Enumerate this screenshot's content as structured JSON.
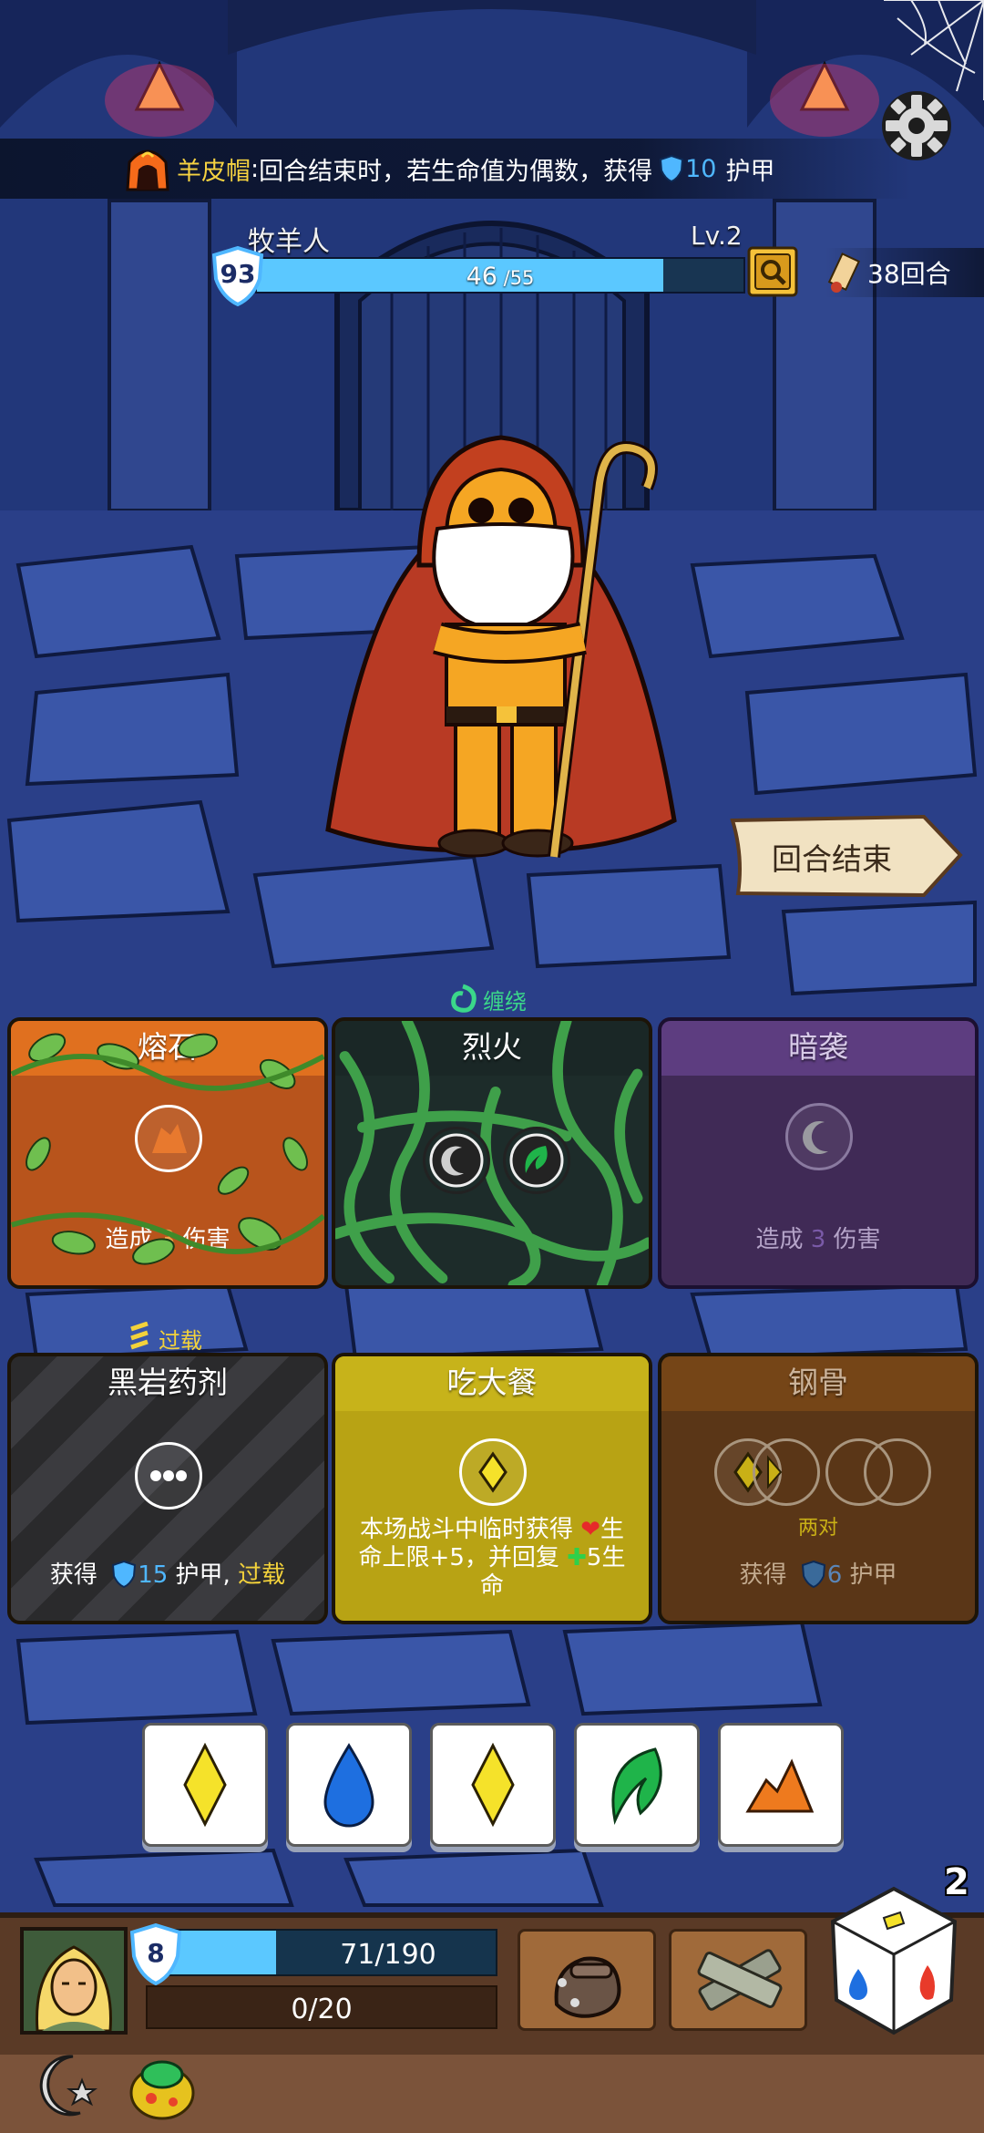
{
  "relic": {
    "name": "羊皮帽",
    "separator": ":",
    "text": "回合结束时，若生命值为偶数，获得",
    "armor_value": "10",
    "armor_word": "护甲"
  },
  "enemy": {
    "name": "牧羊人",
    "level": "Lv.2",
    "armor": "93",
    "hp_current": "46",
    "hp_max": " /55",
    "hp_fraction": 0.836
  },
  "turns": {
    "label": "38回合"
  },
  "end_turn": {
    "label": "回合结束"
  },
  "cards_row1": [
    {
      "title": "熔石",
      "desc_prefix": "造成",
      "value": "3",
      "desc_suffix": "伤害",
      "color": "#e0701f"
    },
    {
      "title": "烈火",
      "status": "缠绕",
      "color": "#1a2726"
    },
    {
      "title": "暗袭",
      "desc_prefix": "造成",
      "value": "3",
      "desc_suffix": "伤害",
      "color": "#5d3d80"
    }
  ],
  "cards_row2": [
    {
      "title": "黑岩药剂",
      "status": "过载",
      "desc_prefix": "获得",
      "value": "15",
      "desc_mid": "护甲,",
      "desc_suffix": "过载"
    },
    {
      "title": "吃大餐",
      "desc_line1": "本场战斗中临时获得",
      "desc_hp": "生",
      "desc_line2": "命上限+5，并回复",
      "desc_heal": "5生",
      "desc_line3": "命"
    },
    {
      "title": "钢骨",
      "pair_label": "两对",
      "desc_prefix": "获得",
      "value": "6",
      "desc_suffix": "护甲"
    }
  ],
  "dice": [
    "yellow-diamond",
    "blue-drop",
    "yellow-diamond",
    "green-leaf",
    "orange-rock"
  ],
  "player": {
    "armor": "8",
    "hp_text": "71/190",
    "hp_fraction": 0.37,
    "energy_text": "0/20"
  },
  "reroll": {
    "count": "2"
  },
  "colors": {
    "hp_bar": "#5bc8ff",
    "accent_yellow": "#f3d23b",
    "accent_green": "#3bd78a",
    "armor_blue": "#4fb7ff"
  }
}
